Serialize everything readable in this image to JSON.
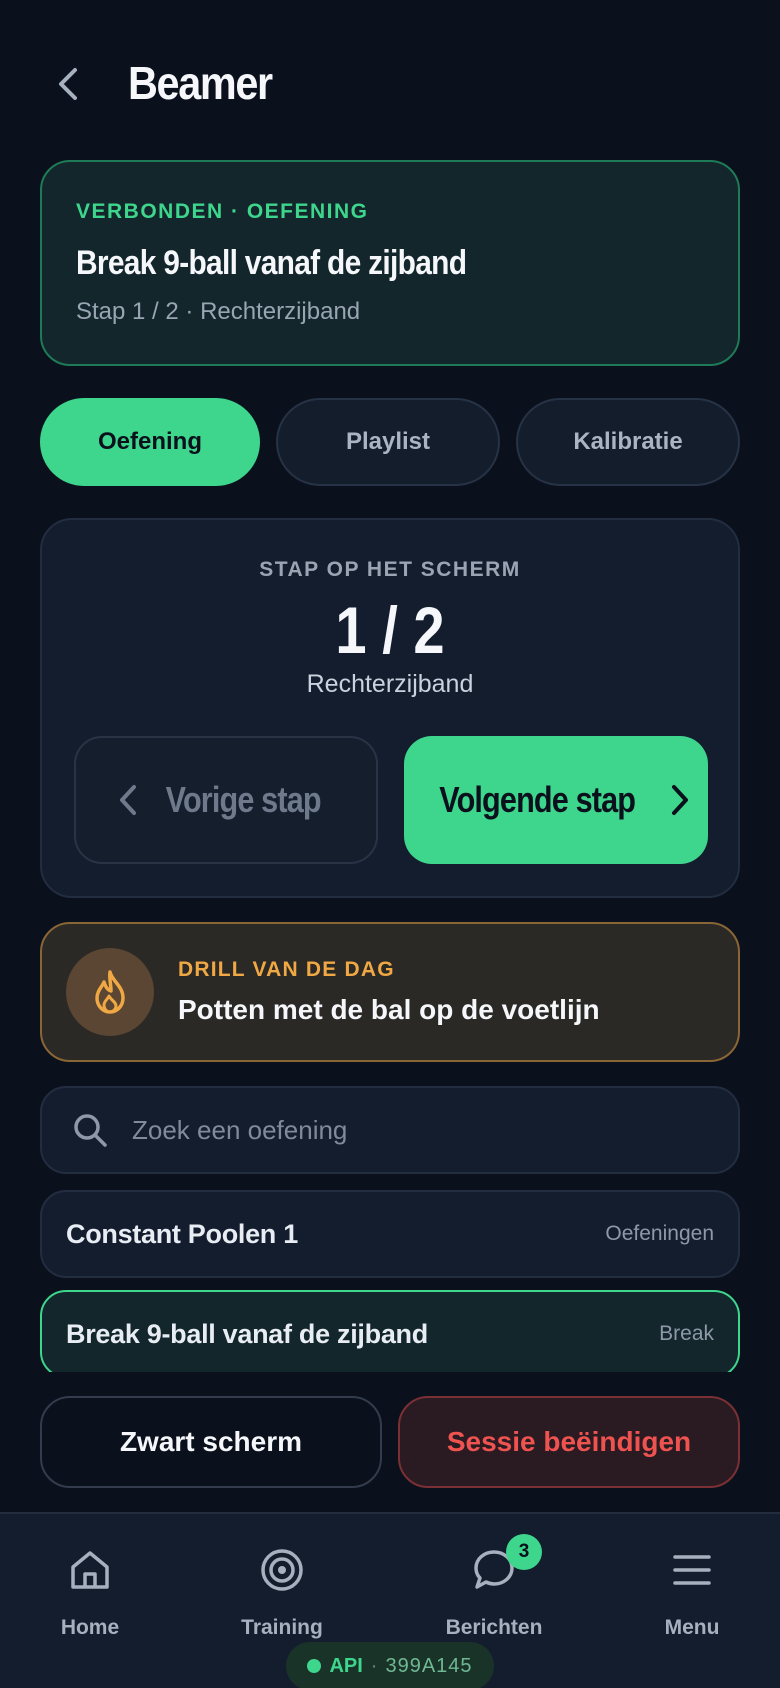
{
  "header": {
    "title": "Beamer"
  },
  "status": {
    "kicker": "VERBONDEN · OEFENING",
    "title": "Break 9-ball vanaf de zijband",
    "subtitle": "Stap 1 / 2 · Rechterzijband"
  },
  "tabs": [
    {
      "label": "Oefening",
      "active": true
    },
    {
      "label": "Playlist",
      "active": false
    },
    {
      "label": "Kalibratie",
      "active": false
    }
  ],
  "step": {
    "kicker": "STAP OP HET SCHERM",
    "count": "1 / 2",
    "name": "Rechterzijband",
    "prev_label": "Vorige stap",
    "next_label": "Volgende stap"
  },
  "drill": {
    "kicker": "DRILL VAN DE DAG",
    "title": "Potten met de bal op de voetlijn",
    "icon": "flame-icon"
  },
  "search": {
    "placeholder": "Zoek een oefening",
    "value": ""
  },
  "list": [
    {
      "title": "Constant Poolen 1",
      "tag": "Oefeningen",
      "selected": false
    },
    {
      "title": "Break 9-ball vanaf de zijband",
      "tag": "Break",
      "selected": true
    }
  ],
  "actions": {
    "black_screen": "Zwart scherm",
    "end_session": "Sessie beëindigen"
  },
  "nav": {
    "items": [
      {
        "label": "Home",
        "icon": "home-icon"
      },
      {
        "label": "Training",
        "icon": "target-icon"
      },
      {
        "label": "Berichten",
        "icon": "chat-icon",
        "badge": "3"
      },
      {
        "label": "Menu",
        "icon": "menu-icon"
      }
    ]
  },
  "api": {
    "label": "API",
    "separator": "·",
    "code": "399A145"
  },
  "colors": {
    "background": "#0b111c",
    "accent": "#3dd68c",
    "warning": "#f0a844",
    "danger": "#ef5350"
  }
}
